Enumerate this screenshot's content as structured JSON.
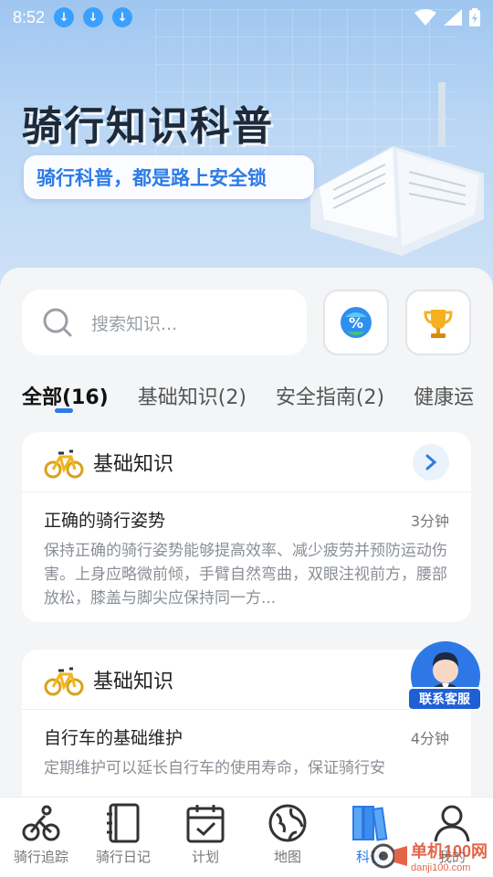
{
  "status": {
    "time": "8:52",
    "download_icons": [
      "download-icon",
      "download-icon",
      "download-icon"
    ]
  },
  "hero": {
    "title": "骑行知识科普",
    "subtitle": "骑行科普，都是路上安全锁"
  },
  "search": {
    "placeholder": "搜索知识..."
  },
  "tabs": [
    {
      "label": "全部(16)",
      "active": true
    },
    {
      "label": "基础知识(2)",
      "active": false
    },
    {
      "label": "安全指南(2)",
      "active": false
    },
    {
      "label": "健康运",
      "active": false
    }
  ],
  "cards": [
    {
      "category": "基础知识",
      "title": "正确的骑行姿势",
      "time": "3分钟",
      "desc": "保持正确的骑行姿势能够提高效率、减少疲劳并预防运动伤害。上身应略微前倾，手臂自然弯曲，双眼注视前方，腰部放松，膝盖与脚尖应保持同一方..."
    },
    {
      "category": "基础知识",
      "title": "自行车的基础维护",
      "time": "4分钟",
      "desc": "定期维护可以延长自行车的使用寿命，保证骑行安"
    }
  ],
  "service": {
    "label": "联系客服"
  },
  "nav": [
    {
      "label": "骑行追踪",
      "icon": "bike-icon"
    },
    {
      "label": "骑行日记",
      "icon": "notebook-icon"
    },
    {
      "label": "计划",
      "icon": "calendar-check-icon"
    },
    {
      "label": "地图",
      "icon": "globe-icon"
    },
    {
      "label": "科普",
      "icon": "books-icon"
    },
    {
      "label": "我的",
      "icon": "person-icon"
    }
  ],
  "watermark": {
    "text": "单机100网",
    "sub": "danji100.com"
  },
  "colors": {
    "accent": "#2c7be5",
    "panel_bg": "#f3f5f7"
  }
}
